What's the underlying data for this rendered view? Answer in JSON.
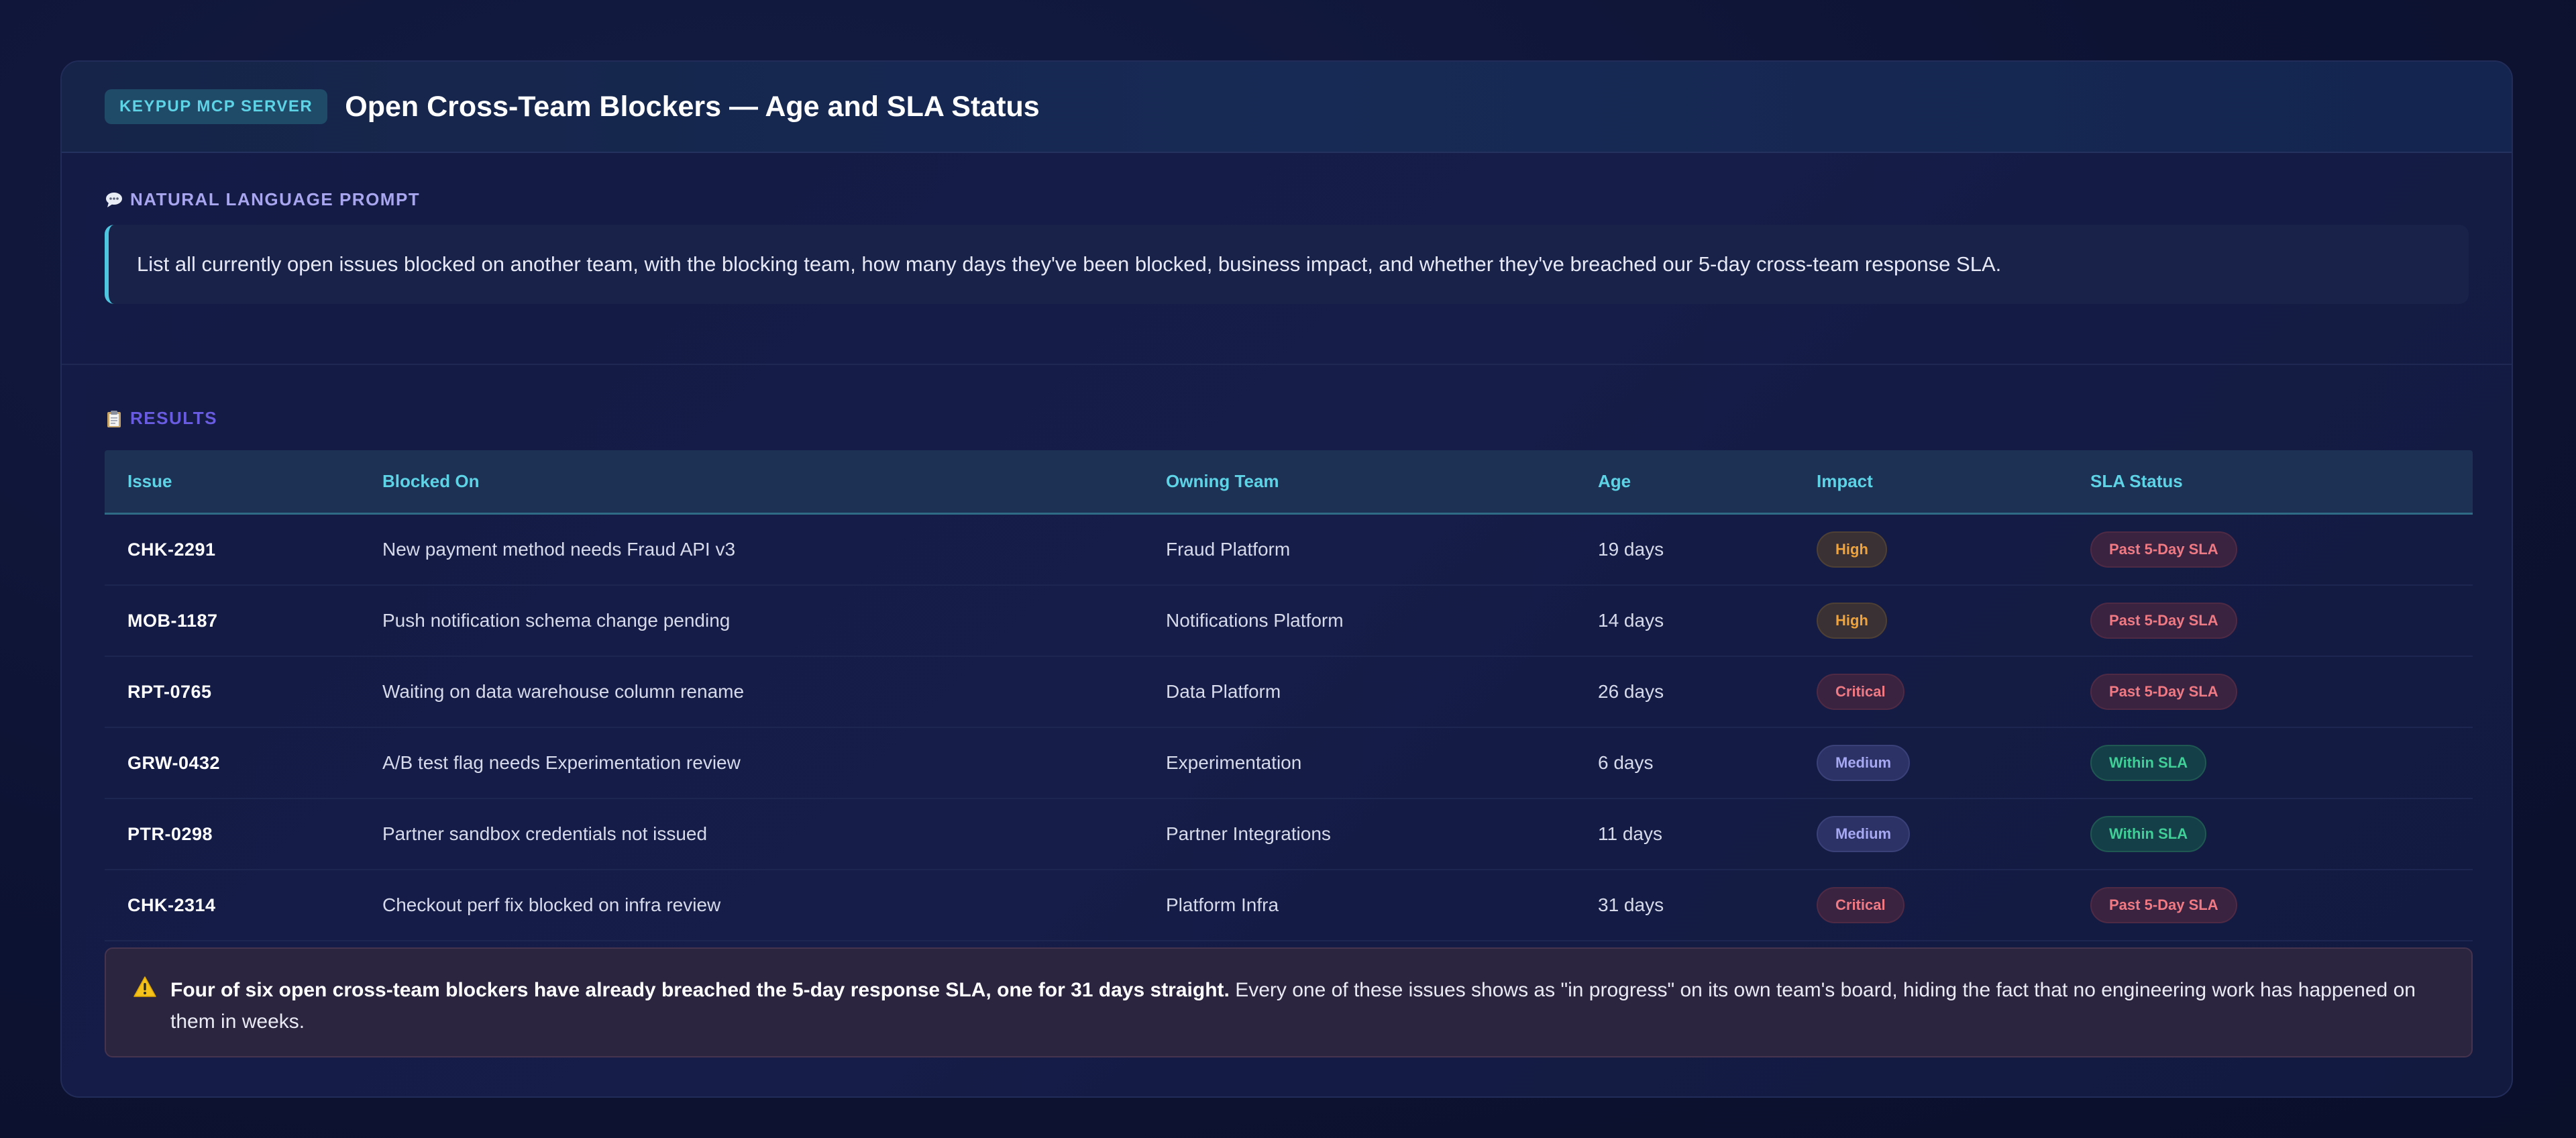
{
  "header": {
    "server_badge": "KEYPUP MCP SERVER",
    "title": "Open Cross-Team Blockers — Age and SLA Status"
  },
  "prompt": {
    "label": "NATURAL LANGUAGE PROMPT",
    "icon": "speech-bubble-icon",
    "text": "List all currently open issues blocked on another team, with the blocking team, how many days they've been blocked, business impact, and whether they've breached our 5-day cross-team response SLA."
  },
  "results": {
    "label": "RESULTS",
    "icon": "clipboard-icon",
    "columns": [
      "Issue",
      "Blocked On",
      "Owning Team",
      "Age",
      "Impact",
      "SLA Status"
    ],
    "rows": [
      {
        "issue": "CHK-2291",
        "blocked_on": "New payment method needs Fraud API v3",
        "team": "Fraud Platform",
        "age": "19 days",
        "impact": "High",
        "sla": "Past 5-Day SLA"
      },
      {
        "issue": "MOB-1187",
        "blocked_on": "Push notification schema change pending",
        "team": "Notifications Platform",
        "age": "14 days",
        "impact": "High",
        "sla": "Past 5-Day SLA"
      },
      {
        "issue": "RPT-0765",
        "blocked_on": "Waiting on data warehouse column rename",
        "team": "Data Platform",
        "age": "26 days",
        "impact": "Critical",
        "sla": "Past 5-Day SLA"
      },
      {
        "issue": "GRW-0432",
        "blocked_on": "A/B test flag needs Experimentation review",
        "team": "Experimentation",
        "age": "6 days",
        "impact": "Medium",
        "sla": "Within SLA"
      },
      {
        "issue": "PTR-0298",
        "blocked_on": "Partner sandbox credentials not issued",
        "team": "Partner Integrations",
        "age": "11 days",
        "impact": "Medium",
        "sla": "Within SLA"
      },
      {
        "issue": "CHK-2314",
        "blocked_on": "Checkout perf fix blocked on infra review",
        "team": "Platform Infra",
        "age": "31 days",
        "impact": "Critical",
        "sla": "Past 5-Day SLA"
      }
    ]
  },
  "alert": {
    "icon": "warning-icon",
    "strong": "Four of six open cross-team blockers have already breached the 5-day response SLA, one for 31 days straight.",
    "text": " Every one of these issues shows as \"in progress\" on its own team's board, hiding the fact that no engineering work has happened on them in weeks."
  },
  "colors": {
    "accent_cyan": "#5fd3e6",
    "high": "#f0a33a",
    "critical": "#f07a84",
    "medium": "#a7a8f2",
    "within": "#3fcf97"
  }
}
